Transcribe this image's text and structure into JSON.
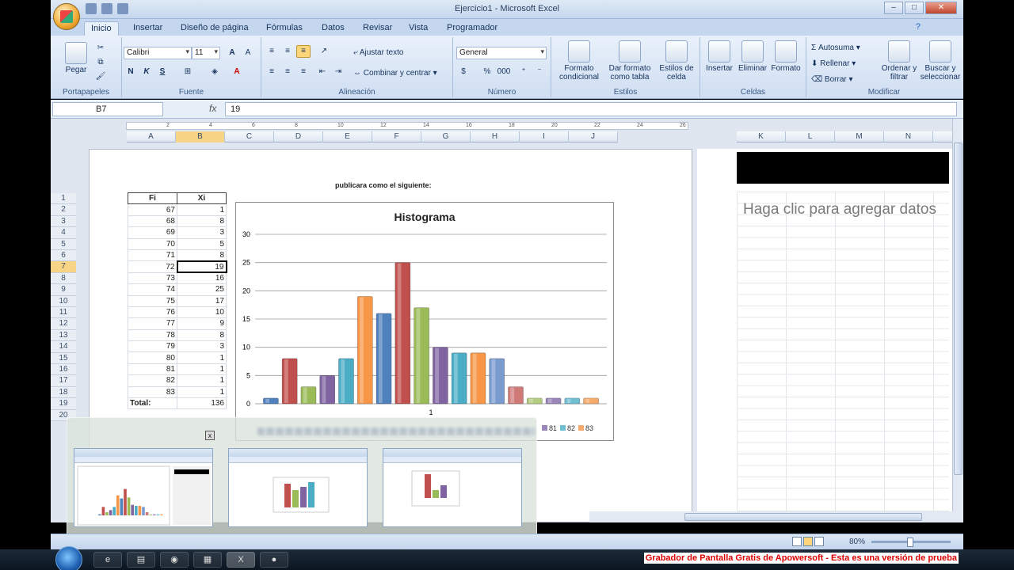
{
  "window": {
    "title": "Ejercicio1 - Microsoft Excel"
  },
  "tabs": [
    "Inicio",
    "Insertar",
    "Diseño de página",
    "Fórmulas",
    "Datos",
    "Revisar",
    "Vista",
    "Programador"
  ],
  "ribbon": {
    "portapapeles": {
      "label": "Portapapeles",
      "paste": "Pegar"
    },
    "fuente": {
      "label": "Fuente",
      "font": "Calibri",
      "size": "11",
      "bold": "N",
      "italic": "K",
      "underline": "S"
    },
    "alineacion": {
      "label": "Alineación",
      "wrap": "Ajustar texto",
      "merge": "Combinar y centrar"
    },
    "numero": {
      "label": "Número",
      "format": "General",
      "percent": "%",
      "thousands": "000"
    },
    "estilos": {
      "label": "Estilos",
      "cond": "Formato condicional",
      "table": "Dar formato como tabla",
      "cell": "Estilos de celda"
    },
    "celdas": {
      "label": "Celdas",
      "insert": "Insertar",
      "delete": "Eliminar",
      "format": "Formato"
    },
    "modificar": {
      "label": "Modificar",
      "autosum": "Autosuma",
      "fill": "Rellenar",
      "clear": "Borrar",
      "sort": "Ordenar y filtrar",
      "find": "Buscar y seleccionar"
    }
  },
  "formula_bar": {
    "cell": "B7",
    "fx": "fx",
    "value": "19"
  },
  "columns_left": [
    "A",
    "B",
    "C",
    "D",
    "E",
    "F",
    "G",
    "H",
    "I",
    "J"
  ],
  "columns_right": [
    "K",
    "L",
    "M",
    "N"
  ],
  "ruler_numbers": [
    "2",
    "4",
    "6",
    "8",
    "10",
    "12",
    "14",
    "16",
    "18",
    "20",
    "22",
    "24",
    "26"
  ],
  "rows": [
    "1",
    "2",
    "3",
    "4",
    "5",
    "6",
    "7",
    "8",
    "9",
    "10",
    "11",
    "12",
    "13",
    "14",
    "15",
    "16",
    "17",
    "18",
    "19",
    "20"
  ],
  "page_heading": "publicara como el siguiente:",
  "table": {
    "headers": [
      "Fi",
      "Xi"
    ],
    "rows": [
      [
        "67",
        "1"
      ],
      [
        "68",
        "8"
      ],
      [
        "69",
        "3"
      ],
      [
        "70",
        "5"
      ],
      [
        "71",
        "8"
      ],
      [
        "72",
        "19"
      ],
      [
        "73",
        "16"
      ],
      [
        "74",
        "25"
      ],
      [
        "75",
        "17"
      ],
      [
        "76",
        "10"
      ],
      [
        "77",
        "9"
      ],
      [
        "78",
        "8"
      ],
      [
        "79",
        "3"
      ],
      [
        "80",
        "1"
      ],
      [
        "81",
        "1"
      ],
      [
        "82",
        "1"
      ],
      [
        "83",
        "1"
      ]
    ],
    "total_label": "Total:",
    "total_value": "136"
  },
  "chart_data": {
    "type": "bar",
    "title": "Histograma",
    "categories": [
      "1"
    ],
    "series": [
      {
        "name": "67",
        "values": [
          1
        ],
        "color": "#4f81bd"
      },
      {
        "name": "68",
        "values": [
          8
        ],
        "color": "#c0504d"
      },
      {
        "name": "69",
        "values": [
          3
        ],
        "color": "#9bbb59"
      },
      {
        "name": "70",
        "values": [
          5
        ],
        "color": "#8064a2"
      },
      {
        "name": "71",
        "values": [
          8
        ],
        "color": "#4bacc6"
      },
      {
        "name": "72",
        "values": [
          19
        ],
        "color": "#f79646"
      },
      {
        "name": "73",
        "values": [
          16
        ],
        "color": "#4f81bd"
      },
      {
        "name": "74",
        "values": [
          25
        ],
        "color": "#c0504d"
      },
      {
        "name": "75",
        "values": [
          17
        ],
        "color": "#9bbb59"
      },
      {
        "name": "76",
        "values": [
          10
        ],
        "color": "#8064a2"
      },
      {
        "name": "77",
        "values": [
          9
        ],
        "color": "#4bacc6"
      },
      {
        "name": "78",
        "values": [
          9
        ],
        "color": "#f79646"
      },
      {
        "name": "79",
        "values": [
          8
        ],
        "color": "#7a9bd0"
      },
      {
        "name": "80",
        "values": [
          3
        ],
        "color": "#d07a78"
      },
      {
        "name": "81",
        "values": [
          1
        ],
        "color": "#b3cc7f"
      },
      {
        "name": "82",
        "values": [
          1
        ],
        "color": "#9a86b8"
      },
      {
        "name": "83",
        "values": [
          1
        ],
        "color": "#6fbfd3"
      },
      {
        "name": "",
        "values": [
          1
        ],
        "color": "#f5a96b"
      }
    ],
    "yticks": [
      "0",
      "5",
      "10",
      "15",
      "20",
      "25",
      "30"
    ],
    "ylim": [
      0,
      30
    ],
    "grid": true,
    "legend": "bottom",
    "legend_visible": [
      "81",
      "82",
      "83"
    ]
  },
  "right_page": {
    "placeholder": "Haga clic para agregar datos"
  },
  "preview": {
    "close": "x"
  },
  "status": {
    "zoom": "80%"
  },
  "watermark": "Grabador de Pantalla Gratis de Apowersoft - Esta es una versión de prueba"
}
